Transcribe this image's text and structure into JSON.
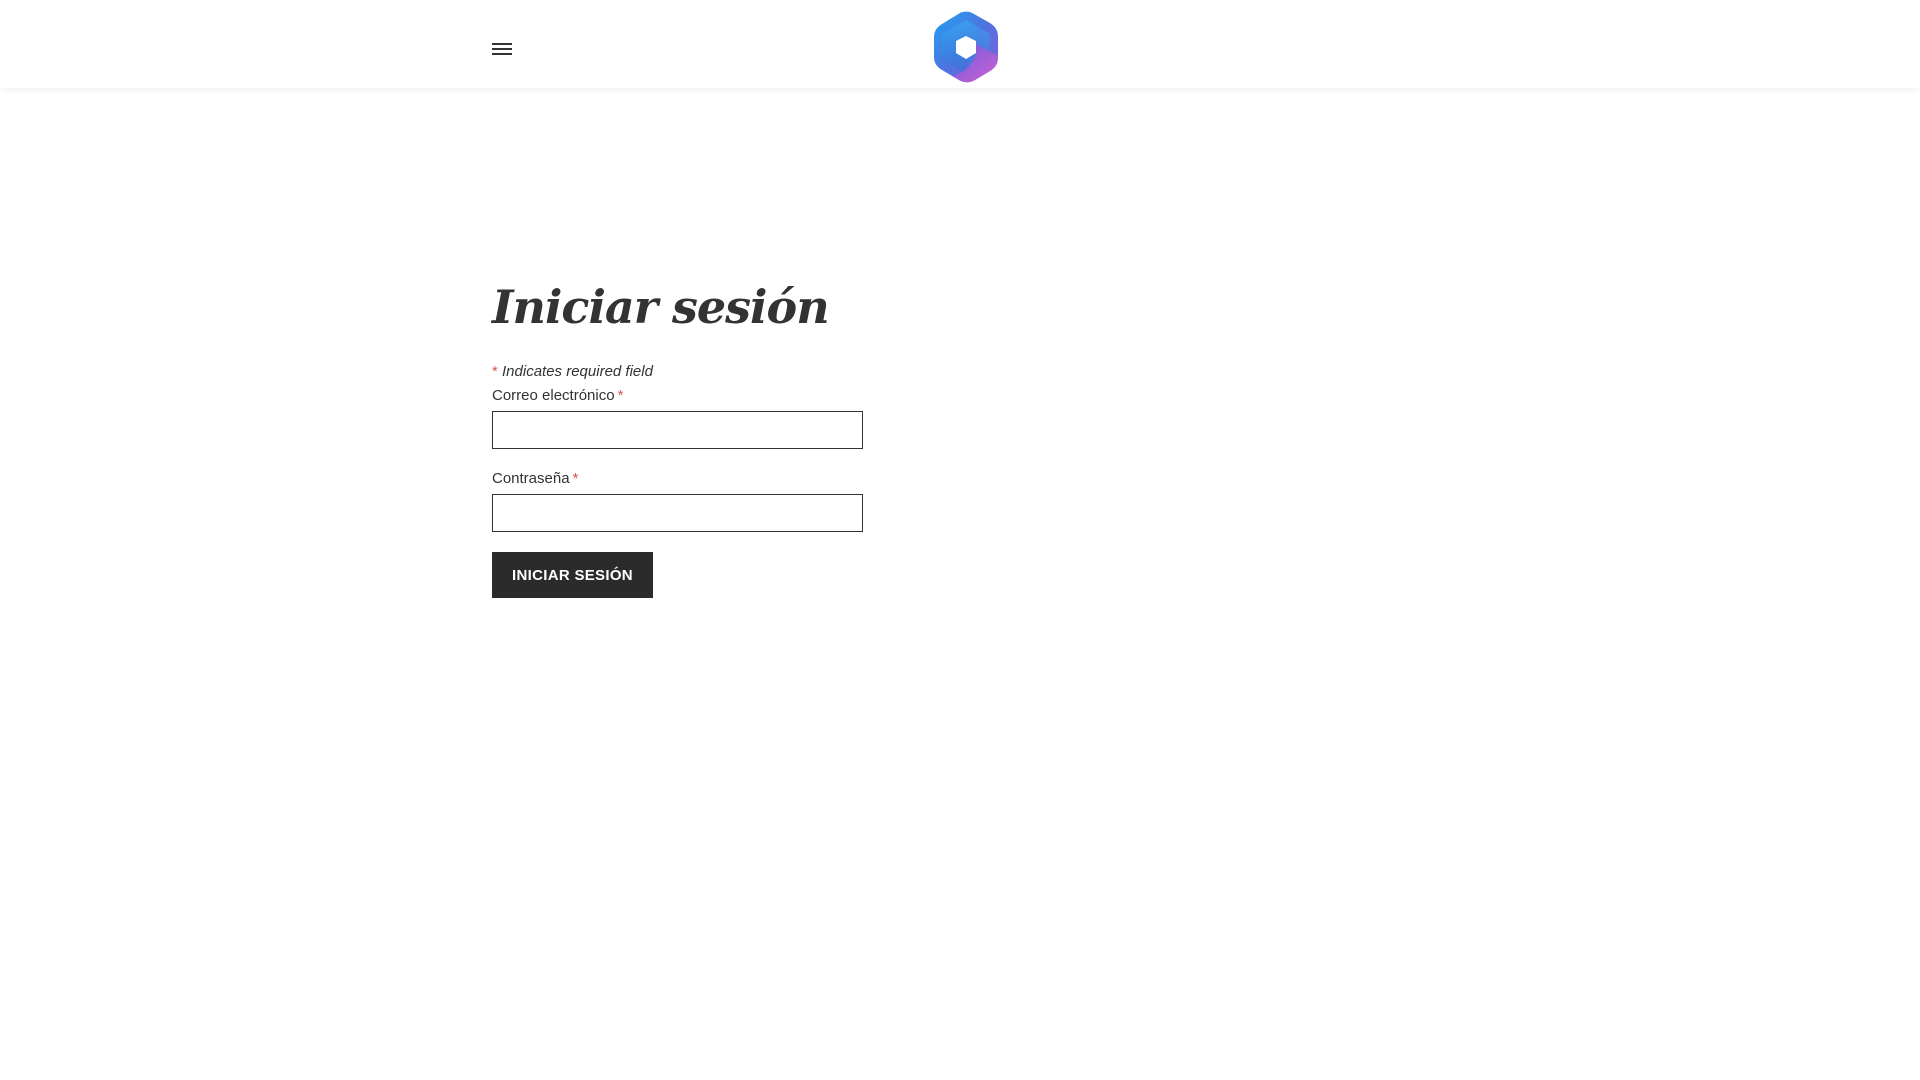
{
  "header": {
    "menu_icon": "hamburger-menu-icon",
    "logo_icon": "microsoft-365-logo-icon",
    "logo_colors": [
      "#2aa0e8",
      "#7b5fd6",
      "#c65bd0"
    ]
  },
  "form": {
    "title": "Iniciar sesión",
    "required_marker": "*",
    "required_note": "Indicates required field",
    "email_label": "Correo electrónico",
    "email_value": "",
    "password_label": "Contraseña",
    "password_value": "",
    "submit_label": "INICIAR SESIÓN"
  },
  "colors": {
    "button_bg": "#2b2b2b",
    "required_asterisk": "#d9534f",
    "text": "#333333"
  }
}
